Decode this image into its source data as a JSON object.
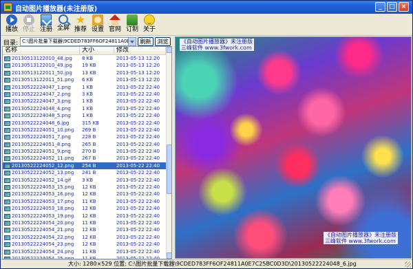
{
  "window": {
    "title": "自动图片播放器(未注册版)",
    "controls": {
      "minimize": "_",
      "maximize": "□",
      "close": "×"
    }
  },
  "toolbar": [
    {
      "label": "播放",
      "icon": "play-icon",
      "enabled": true
    },
    {
      "label": "停止",
      "icon": "stop-icon",
      "enabled": false
    },
    {
      "label": "注册",
      "icon": "register-icon",
      "enabled": true
    },
    {
      "label": "全屏",
      "icon": "fullscreen-icon",
      "enabled": true
    },
    {
      "label": "推荐",
      "icon": "star-icon",
      "enabled": true
    },
    {
      "label": "设置",
      "icon": "settings-icon",
      "enabled": true
    },
    {
      "label": "官网",
      "icon": "home-icon",
      "enabled": true
    },
    {
      "label": "订制",
      "icon": "order-icon",
      "enabled": true
    },
    {
      "label": "关于",
      "icon": "about-icon",
      "enabled": true
    }
  ],
  "directory": {
    "label": "目录:",
    "value": "C:\\图片批量下载器\\9CDED783FF6OF24811A0E7",
    "refresh": "刷新",
    "browse": "浏览"
  },
  "filelist": {
    "columns": {
      "name": "名称",
      "size": "大小",
      "modified": "修改"
    },
    "selected_index": 15,
    "rows": [
      {
        "name": "20130513122010_48.jpg",
        "size": "8 KB",
        "modified": "2013-05-13 12:20"
      },
      {
        "name": "20130513122010_49.jpg",
        "size": "19 KB",
        "modified": "2013-05-13 12:20"
      },
      {
        "name": "20130513122011_50.jpg",
        "size": "13 KB",
        "modified": "2013-05-13 12:20"
      },
      {
        "name": "20130513122011_51.png",
        "size": "6 KB",
        "modified": "2013-05-13 12:20"
      },
      {
        "name": "20130522224047_1.png",
        "size": "1 KB",
        "modified": "2013-05-22 22:40"
      },
      {
        "name": "20130522224047_2.png",
        "size": "3 KB",
        "modified": "2013-05-22 22:40"
      },
      {
        "name": "20130522224047_3.png",
        "size": "1 KB",
        "modified": "2013-05-22 22:40"
      },
      {
        "name": "20130522224048_4.png",
        "size": "1 KB",
        "modified": "2013-05-22 22:40"
      },
      {
        "name": "20130522224048_5.png",
        "size": "1 KB",
        "modified": "2013-05-22 22:40"
      },
      {
        "name": "20130522224048_6.jpg",
        "size": "315 KB",
        "modified": "2013-05-22 22:40"
      },
      {
        "name": "20130522224051_10.png",
        "size": "269 B",
        "modified": "2013-05-22 22:40"
      },
      {
        "name": "20130522224051_7.png",
        "size": "228 B",
        "modified": "2013-05-22 22:40"
      },
      {
        "name": "20130522224051_8.png",
        "size": "265 B",
        "modified": "2013-05-22 22:40"
      },
      {
        "name": "20130522224051_9.png",
        "size": "270 B",
        "modified": "2013-05-22 22:40"
      },
      {
        "name": "20130522224052_11.png",
        "size": "267 B",
        "modified": "2013-05-22 22:40"
      },
      {
        "name": "20130522224052_12.png",
        "size": "254 B",
        "modified": "2013-05-22 22:40"
      },
      {
        "name": "20130522224052_13.png",
        "size": "241 B",
        "modified": "2013-05-22 22:40"
      },
      {
        "name": "20130522224052_14.gif",
        "size": "3 KB",
        "modified": "2013-05-22 22:40"
      },
      {
        "name": "20130522224053_15.png",
        "size": "12 KB",
        "modified": "2013-05-22 22:40"
      },
      {
        "name": "20130522224053_16.png",
        "size": "12 KB",
        "modified": "2013-05-22 22:40"
      },
      {
        "name": "20130522224053_17.png",
        "size": "11 KB",
        "modified": "2013-05-22 22:40"
      },
      {
        "name": "20130522224053_18.png",
        "size": "12 KB",
        "modified": "2013-05-22 22:40"
      },
      {
        "name": "20130522224053_19.png",
        "size": "12 KB",
        "modified": "2013-05-22 22:40"
      },
      {
        "name": "20130522224054_20.png",
        "size": "11 KB",
        "modified": "2013-05-22 22:40"
      },
      {
        "name": "20130522224054_21.png",
        "size": "12 KB",
        "modified": "2013-05-22 22:40"
      },
      {
        "name": "20130522224054_22.png",
        "size": "12 KB",
        "modified": "2013-05-22 22:40"
      },
      {
        "name": "20130522224054_23.png",
        "size": "12 KB",
        "modified": "2013-05-22 22:40"
      },
      {
        "name": "20130522224054_24.png",
        "size": "11 KB",
        "modified": "2013-05-22 22:40"
      },
      {
        "name": "20130522224054_25.png",
        "size": "11 KB",
        "modified": "2013-05-22 22:40"
      }
    ]
  },
  "viewer": {
    "watermark_top_line1": "《自动图片播放器》未注册版",
    "watermark_top_line2": "三峰软件 www.3fwork.com",
    "watermark_bottom_line1": "《自动图片播放器》未注册版",
    "watermark_bottom_line2": "三峰软件 www.3fwork.com"
  },
  "status": {
    "text": "大小: 1280×529 位置: C:\\图片批量下载器\\9CDED783FF6OF24811A0E7C25BC0D3D\\20130522224048_6.jpg"
  }
}
